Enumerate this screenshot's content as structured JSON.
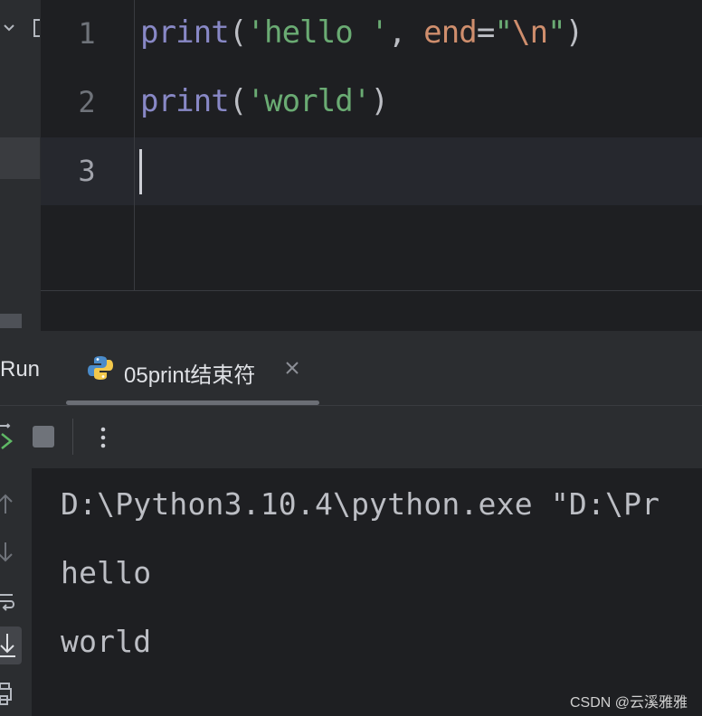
{
  "editor": {
    "lines": [
      {
        "number": "1",
        "fn": "print",
        "open": "(",
        "str": "'hello '",
        "comma": ", ",
        "kw": "end",
        "eq": "=",
        "q1": "\"",
        "esc": "\\n",
        "q2": "\"",
        "close": ")"
      },
      {
        "number": "2",
        "fn": "print",
        "open": "(",
        "str": "'world'",
        "close": ")"
      },
      {
        "number": "3"
      }
    ]
  },
  "run": {
    "title": "Run",
    "tab": {
      "label": "05print结束符",
      "icon": "python-icon"
    },
    "toolbar": {
      "icons": [
        "rerun-icon",
        "stop-icon",
        "more-options-icon"
      ]
    },
    "rail_icons": [
      "scroll-up-icon",
      "scroll-down-icon",
      "soft-wrap-icon",
      "scroll-to-end-icon",
      "print-icon"
    ]
  },
  "console": {
    "lines": [
      "D:\\Python3.10.4\\python.exe \"D:\\Pr",
      "hello",
      "world"
    ]
  },
  "watermark": "CSDN @云溪雅雅"
}
